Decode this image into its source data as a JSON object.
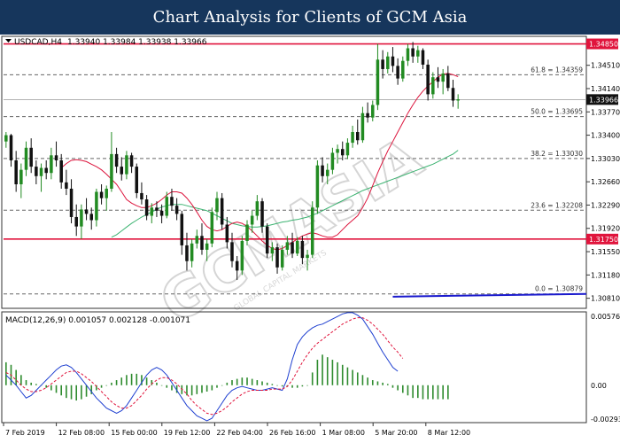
{
  "header": {
    "title": "Chart Analysis for Clients of GCM Asia"
  },
  "watermark": {
    "text": "GCMASIA",
    "subtext": "GLOBAL CAPITAL MARKETS"
  },
  "instrument": {
    "label": "USDCAD,H4",
    "ohlc": "1.33940 1.33984 1.33938 1.33966"
  },
  "price_axis": {
    "ticks": [
      "1.34510",
      "1.34140",
      "1.33770",
      "1.33400",
      "1.33030",
      "1.32660",
      "1.32290",
      "1.31920",
      "1.31550",
      "1.31180",
      "1.30810"
    ],
    "current_price": "1.33966"
  },
  "levels": {
    "resistance": "1.34850",
    "support": "1.31750"
  },
  "fib_levels": [
    {
      "label": "61.8 = 1.34359",
      "value": 1.34359
    },
    {
      "label": "50.0 = 1.33695",
      "value": 1.33695
    },
    {
      "label": "38.2 = 1.33030",
      "value": 1.3303
    },
    {
      "label": "23.6 = 1.32208",
      "value": 1.32208
    },
    {
      "label": "0.0 = 1.30879",
      "value": 1.30879
    }
  ],
  "macd": {
    "label": "MACD(12,26,9) 0.001057 0.002128 -0.001071",
    "ticks": [
      "0.005761",
      "0.00",
      "-0.002938"
    ]
  },
  "time_axis": {
    "labels": [
      "7 Feb 2019",
      "12 Feb 08:00",
      "15 Feb 00:00",
      "19 Feb 12:00",
      "22 Feb 04:00",
      "26 Feb 16:00",
      "1 Mar 08:00",
      "5 Mar 20:00",
      "8 Mar 12:00"
    ]
  },
  "colors": {
    "header_bg": "#16365c",
    "bull": "#228b22",
    "bear": "#111111",
    "ma_fast": "#dc143c",
    "ma_slow": "#3cb371",
    "level_line": "#e0143c",
    "macd_line": "#1e3fd0",
    "signal_line": "#e0143c",
    "hist": "#2e8b2e",
    "trend": "#1a1acd"
  },
  "chart_data": {
    "type": "candlestick",
    "symbol": "USDCAD",
    "timeframe": "H4",
    "ylim": [
      1.3065,
      1.3497
    ],
    "candles": [
      [
        1.333,
        1.3345,
        1.332,
        1.334
      ],
      [
        1.334,
        1.3342,
        1.329,
        1.33
      ],
      [
        1.33,
        1.3315,
        1.325,
        1.3262
      ],
      [
        1.3262,
        1.3295,
        1.324,
        1.3285
      ],
      [
        1.3285,
        1.333,
        1.3275,
        1.332
      ],
      [
        1.332,
        1.3335,
        1.328,
        1.329
      ],
      [
        1.329,
        1.33,
        1.3262,
        1.3275
      ],
      [
        1.3275,
        1.3295,
        1.325,
        1.3288
      ],
      [
        1.3288,
        1.33,
        1.327,
        1.328
      ],
      [
        1.328,
        1.332,
        1.327,
        1.3308
      ],
      [
        1.3308,
        1.333,
        1.329,
        1.33
      ],
      [
        1.33,
        1.331,
        1.3255,
        1.3265
      ],
      [
        1.3265,
        1.3285,
        1.3245,
        1.3255
      ],
      [
        1.3255,
        1.327,
        1.32,
        1.321
      ],
      [
        1.321,
        1.323,
        1.318,
        1.3195
      ],
      [
        1.3195,
        1.323,
        1.3175,
        1.3222
      ],
      [
        1.3222,
        1.324,
        1.3205,
        1.3215
      ],
      [
        1.3215,
        1.3225,
        1.319,
        1.3205
      ],
      [
        1.3205,
        1.3255,
        1.3195,
        1.325
      ],
      [
        1.325,
        1.3262,
        1.323,
        1.324
      ],
      [
        1.324,
        1.326,
        1.322,
        1.3255
      ],
      [
        1.3255,
        1.3345,
        1.325,
        1.331
      ],
      [
        1.331,
        1.332,
        1.328,
        1.329
      ],
      [
        1.329,
        1.3305,
        1.3268,
        1.3278
      ],
      [
        1.3278,
        1.3315,
        1.327,
        1.3308
      ],
      [
        1.3308,
        1.3312,
        1.328,
        1.329
      ],
      [
        1.329,
        1.3295,
        1.324,
        1.3248
      ],
      [
        1.3248,
        1.3265,
        1.323,
        1.3238
      ],
      [
        1.3238,
        1.3245,
        1.3205,
        1.3212
      ],
      [
        1.3212,
        1.3232,
        1.32,
        1.3225
      ],
      [
        1.3225,
        1.3235,
        1.321,
        1.322
      ],
      [
        1.322,
        1.323,
        1.32,
        1.3212
      ],
      [
        1.3212,
        1.325,
        1.3208,
        1.3242
      ],
      [
        1.3242,
        1.3255,
        1.322,
        1.3228
      ],
      [
        1.3228,
        1.324,
        1.3205,
        1.3215
      ],
      [
        1.3215,
        1.322,
        1.315,
        1.3165
      ],
      [
        1.3165,
        1.3185,
        1.3125,
        1.314
      ],
      [
        1.314,
        1.3175,
        1.313,
        1.3168
      ],
      [
        1.3168,
        1.319,
        1.316,
        1.318
      ],
      [
        1.318,
        1.32,
        1.315,
        1.3158
      ],
      [
        1.3158,
        1.3175,
        1.314,
        1.3168
      ],
      [
        1.3168,
        1.3225,
        1.3162,
        1.3218
      ],
      [
        1.3218,
        1.325,
        1.3205,
        1.324
      ],
      [
        1.324,
        1.3248,
        1.319,
        1.3198
      ],
      [
        1.3198,
        1.321,
        1.316,
        1.317
      ],
      [
        1.317,
        1.3185,
        1.313,
        1.314
      ],
      [
        1.314,
        1.3148,
        1.311,
        1.3125
      ],
      [
        1.3125,
        1.318,
        1.3118,
        1.3172
      ],
      [
        1.3172,
        1.3205,
        1.3165,
        1.3198
      ],
      [
        1.3198,
        1.322,
        1.3185,
        1.3212
      ],
      [
        1.3212,
        1.3245,
        1.3205,
        1.3235
      ],
      [
        1.3235,
        1.324,
        1.3185,
        1.3195
      ],
      [
        1.3195,
        1.32,
        1.3145,
        1.3152
      ],
      [
        1.3152,
        1.317,
        1.314,
        1.3162
      ],
      [
        1.3162,
        1.3168,
        1.312,
        1.313
      ],
      [
        1.313,
        1.3165,
        1.3125,
        1.3158
      ],
      [
        1.3158,
        1.318,
        1.315,
        1.317
      ],
      [
        1.317,
        1.3185,
        1.3145,
        1.3152
      ],
      [
        1.3152,
        1.3178,
        1.3148,
        1.3172
      ],
      [
        1.3172,
        1.318,
        1.3135,
        1.3145
      ],
      [
        1.3145,
        1.3158,
        1.3125,
        1.315
      ],
      [
        1.315,
        1.3235,
        1.3145,
        1.3225
      ],
      [
        1.3225,
        1.33,
        1.3215,
        1.3292
      ],
      [
        1.3292,
        1.3305,
        1.3265,
        1.3275
      ],
      [
        1.3275,
        1.3295,
        1.3262,
        1.3285
      ],
      [
        1.3285,
        1.332,
        1.3278,
        1.3312
      ],
      [
        1.3312,
        1.3325,
        1.3295,
        1.3318
      ],
      [
        1.3318,
        1.333,
        1.33,
        1.3308
      ],
      [
        1.3308,
        1.3335,
        1.3302,
        1.3328
      ],
      [
        1.3328,
        1.3355,
        1.332,
        1.3345
      ],
      [
        1.3345,
        1.3365,
        1.3325,
        1.3332
      ],
      [
        1.3332,
        1.3385,
        1.3328,
        1.3375
      ],
      [
        1.3375,
        1.3392,
        1.336,
        1.3368
      ],
      [
        1.3368,
        1.3395,
        1.3362,
        1.3388
      ],
      [
        1.3388,
        1.3485,
        1.338,
        1.346
      ],
      [
        1.346,
        1.3475,
        1.343,
        1.3445
      ],
      [
        1.3445,
        1.3472,
        1.3438,
        1.3465
      ],
      [
        1.3465,
        1.348,
        1.344,
        1.345
      ],
      [
        1.345,
        1.3462,
        1.342,
        1.343
      ],
      [
        1.343,
        1.3465,
        1.3425,
        1.3458
      ],
      [
        1.3458,
        1.3485,
        1.345,
        1.3478
      ],
      [
        1.3478,
        1.3488,
        1.3455,
        1.3465
      ],
      [
        1.3465,
        1.3482,
        1.3455,
        1.3475
      ],
      [
        1.3475,
        1.3478,
        1.3445,
        1.3452
      ],
      [
        1.3452,
        1.346,
        1.3395,
        1.3405
      ],
      [
        1.3405,
        1.344,
        1.3398,
        1.3432
      ],
      [
        1.3432,
        1.3448,
        1.3415,
        1.3425
      ],
      [
        1.3425,
        1.3445,
        1.3405,
        1.3438
      ],
      [
        1.3438,
        1.345,
        1.341,
        1.3415
      ],
      [
        1.3415,
        1.3428,
        1.3385,
        1.3395
      ],
      [
        1.3395,
        1.3405,
        1.3382,
        1.3397
      ]
    ],
    "ma_fast": [
      1.3288,
      1.3295,
      1.33,
      1.3301,
      1.33,
      1.3298,
      1.3294,
      1.329,
      1.3285,
      1.3278,
      1.327,
      1.3262,
      1.325,
      1.3238,
      1.3232,
      1.3228,
      1.3225,
      1.3225,
      1.3228,
      1.3232,
      1.3238,
      1.3245,
      1.325,
      1.325,
      1.3248,
      1.324,
      1.323,
      1.3218,
      1.3205,
      1.3195,
      1.319,
      1.3188,
      1.319,
      1.3195,
      1.32,
      1.3202,
      1.32,
      1.3195,
      1.3188,
      1.318,
      1.3172,
      1.3165,
      1.316,
      1.3158,
      1.316,
      1.3165,
      1.317,
      1.3175,
      1.318,
      1.3183,
      1.3185,
      1.3183,
      1.318,
      1.3178,
      1.3178,
      1.3182,
      1.319,
      1.3198,
      1.3205,
      1.3212,
      1.3225,
      1.324,
      1.326,
      1.328,
      1.3298,
      1.3315,
      1.333,
      1.3345,
      1.336,
      1.3375,
      1.3388,
      1.34,
      1.341,
      1.3418,
      1.3425,
      1.3432,
      1.3437,
      1.3438,
      1.3436,
      1.3433
    ],
    "ma_slow": [
      1.3178,
      1.3182,
      1.3188,
      1.3194,
      1.32,
      1.3205,
      1.321,
      1.3214,
      1.3218,
      1.3222,
      1.3226,
      1.3228,
      1.323,
      1.323,
      1.323,
      1.3228,
      1.3226,
      1.3224,
      1.3222,
      1.322,
      1.3216,
      1.3212,
      1.3208,
      1.3204,
      1.32,
      1.3198,
      1.3196,
      1.3195,
      1.3194,
      1.3194,
      1.3195,
      1.3196,
      1.3198,
      1.32,
      1.3202,
      1.3203,
      1.3205,
      1.3206,
      1.3208,
      1.321,
      1.3213,
      1.3216,
      1.322,
      1.3224,
      1.3228,
      1.3232,
      1.3236,
      1.324,
      1.3244,
      1.3248,
      1.3252,
      1.3255,
      1.3258,
      1.3261,
      1.3264,
      1.3267,
      1.327,
      1.3273,
      1.3276,
      1.3279,
      1.3282,
      1.3285,
      1.3288,
      1.3291,
      1.3294,
      1.3298,
      1.3302,
      1.3306,
      1.331,
      1.3316
    ],
    "macd_line": [
      0.0008,
      0.0004,
      0.0,
      -0.0005,
      -0.001,
      -0.0008,
      -0.0004,
      0.0,
      0.0004,
      0.0008,
      0.0012,
      0.0015,
      0.0016,
      0.0014,
      0.001,
      0.0005,
      0.0,
      -0.0005,
      -0.001,
      -0.0014,
      -0.0018,
      -0.002,
      -0.0022,
      -0.002,
      -0.0016,
      -0.001,
      -0.0004,
      0.0002,
      0.0008,
      0.0012,
      0.0014,
      0.0012,
      0.0008,
      0.0002,
      -0.0004,
      -0.001,
      -0.0016,
      -0.002,
      -0.0024,
      -0.0026,
      -0.0028,
      -0.0026,
      -0.002,
      -0.0014,
      -0.0008,
      -0.0004,
      -0.0002,
      -0.0001,
      -0.0002,
      -0.0003,
      -0.0004,
      -0.0004,
      -0.0003,
      -0.0002,
      -0.0003,
      -0.0004,
      0.0005,
      0.002,
      0.0032,
      0.0038,
      0.0042,
      0.0045,
      0.0047,
      0.0048,
      0.005,
      0.0052,
      0.0054,
      0.0056,
      0.0057,
      0.0057,
      0.0055,
      0.0052,
      0.0046,
      0.004,
      0.0033,
      0.0026,
      0.002,
      0.0014,
      0.0011
    ],
    "signal_line": [
      0.001,
      0.0008,
      0.0004,
      0.0,
      -0.0003,
      -0.0005,
      -0.0005,
      -0.0004,
      -0.0002,
      0.0001,
      0.0004,
      0.0007,
      0.001,
      0.0011,
      0.0011,
      0.0009,
      0.0006,
      0.0003,
      -0.0001,
      -0.0005,
      -0.0009,
      -0.0013,
      -0.0016,
      -0.0018,
      -0.0018,
      -0.0016,
      -0.0012,
      -0.0008,
      -0.0003,
      0.0001,
      0.0004,
      0.0006,
      0.0006,
      0.0004,
      0.0001,
      -0.0003,
      -0.0007,
      -0.0012,
      -0.0016,
      -0.0019,
      -0.0022,
      -0.0023,
      -0.0022,
      -0.002,
      -0.0017,
      -0.0013,
      -0.001,
      -0.0007,
      -0.0005,
      -0.0004,
      -0.0004,
      -0.0004,
      -0.0004,
      -0.0003,
      -0.0003,
      -0.0003,
      -0.0001,
      0.0004,
      0.0011,
      0.0018,
      0.0024,
      0.0029,
      0.0033,
      0.0036,
      0.0039,
      0.0042,
      0.0045,
      0.0048,
      0.005,
      0.0052,
      0.0053,
      0.0053,
      0.0051,
      0.0048,
      0.0044,
      0.004,
      0.0035,
      0.003,
      0.0026,
      0.0021
    ],
    "histogram": [
      0.0018,
      0.0016,
      0.0012,
      0.0008,
      0.0004,
      0.0002,
      0.0001,
      0.0,
      -0.0002,
      -0.0004,
      -0.0006,
      -0.0008,
      -0.001,
      -0.0011,
      -0.0012,
      -0.0011,
      -0.0009,
      -0.0007,
      -0.0004,
      -0.0002,
      0.0,
      0.0002,
      0.0004,
      0.0006,
      0.0008,
      0.0009,
      0.0009,
      0.0008,
      0.0006,
      0.0004,
      0.0002,
      0.0,
      -0.0002,
      -0.0004,
      -0.0006,
      -0.0007,
      -0.0008,
      -0.0008,
      -0.0007,
      -0.0006,
      -0.0005,
      -0.0004,
      -0.0002,
      0.0,
      0.0002,
      0.0004,
      0.0005,
      0.0006,
      0.0006,
      0.0005,
      0.0004,
      0.0003,
      0.0002,
      0.0001,
      0.0,
      -0.0001,
      -0.0001,
      -0.0002,
      -0.0002,
      -0.0001,
      0.0,
      0.001,
      0.002,
      0.0024,
      0.0022,
      0.002,
      0.0018,
      0.0016,
      0.0014,
      0.0012,
      0.001,
      0.0008,
      0.0006,
      0.0004,
      0.0003,
      0.0002,
      0.0001,
      -0.0002,
      -0.0004,
      -0.0006,
      -0.0008,
      -0.001,
      -0.001,
      -0.0011,
      -0.0011,
      -0.0011,
      -0.0011,
      -0.0011,
      -0.0011
    ],
    "macd_ylim": [
      -0.002938,
      0.005761
    ],
    "trend_line": {
      "from": [
        77,
        1.30835
      ],
      "to": [
        100,
        1.30879
      ]
    }
  }
}
